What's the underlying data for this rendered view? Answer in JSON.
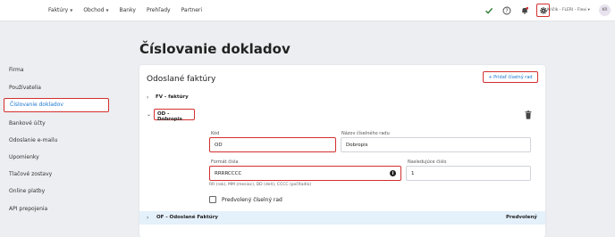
{
  "topnav": {
    "items": [
      {
        "label": "Faktúry",
        "dropdown": true
      },
      {
        "label": "Obchod",
        "dropdown": true
      },
      {
        "label": "Banky",
        "dropdown": false
      },
      {
        "label": "Prehľady",
        "dropdown": false
      },
      {
        "label": "Partneri",
        "dropdown": false
      }
    ],
    "user_label": "Kričík - FLERI - Flexi",
    "avatar_initials": "KR",
    "icons": [
      "check-icon",
      "help-icon",
      "notifications-icon",
      "gear-icon"
    ]
  },
  "sidebar": {
    "items": [
      {
        "label": "Firma"
      },
      {
        "label": "Používatelia"
      },
      {
        "label": "Číslovanie dokladov",
        "active": true
      },
      {
        "label": "Bankové účty"
      },
      {
        "label": "Odoslanie e-mailu"
      },
      {
        "label": "Upomienky"
      },
      {
        "label": "Tlačové zostavy"
      },
      {
        "label": "Online platby"
      },
      {
        "label": "API prepojenia"
      }
    ]
  },
  "page": {
    "title": "Číslovanie dokladov"
  },
  "card": {
    "title": "Odoslané faktúry",
    "add_button": "+ Pridať číselný rad",
    "rows": {
      "fv": "FV - faktúry",
      "od": "OD - Dobropis",
      "of": "OF - Odoslané Faktúry",
      "of_default": "Predvolený"
    },
    "form": {
      "kod_label": "Kód",
      "kod_value": "OD",
      "nazov_label": "Názov číselného radu",
      "nazov_value": "Dobropis",
      "format_label": "Formát čísla",
      "format_value": "RRRRCCCC",
      "next_label": "Nasledujúce číslo",
      "next_value": "1",
      "hint": "RR (rok), MM (mesiac), DD (deň), CCCC (počítadlo)",
      "default_label": "Predvolený číselný rad"
    }
  },
  "colors": {
    "highlight": "#d32f2f",
    "link": "#1976d2",
    "check": "#2e7d32",
    "selected_row": "#e4f0fa"
  }
}
